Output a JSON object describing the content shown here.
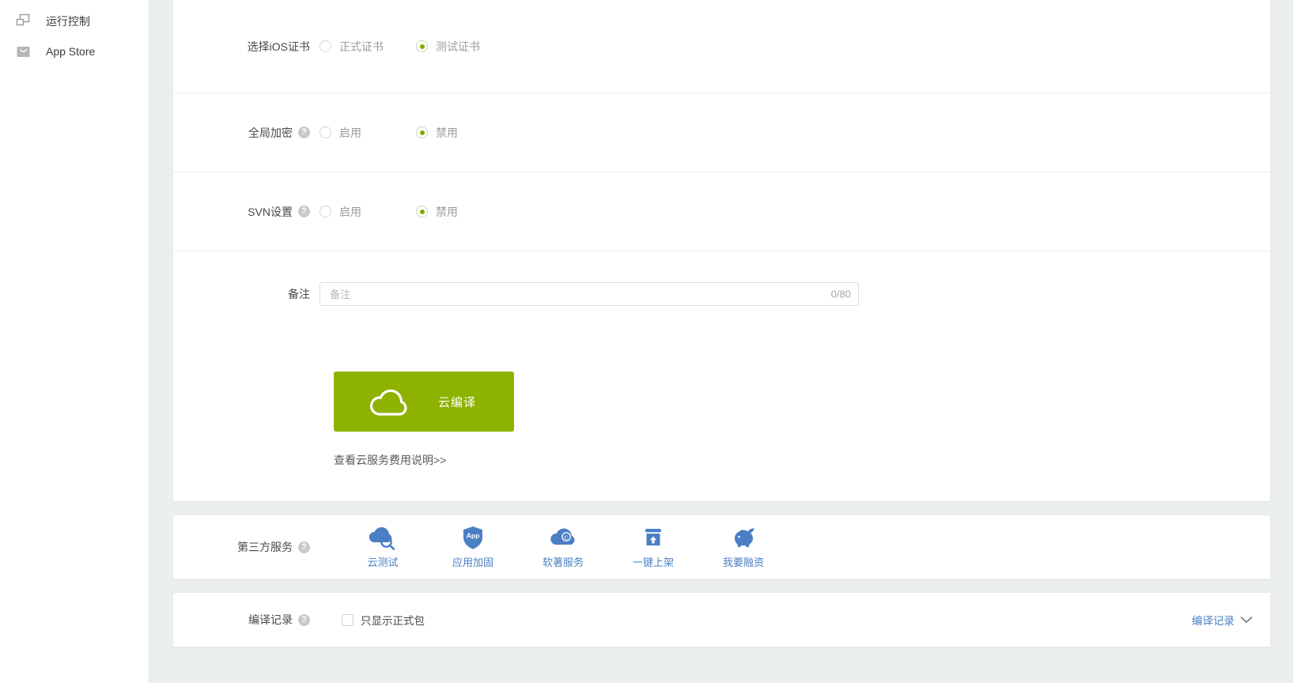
{
  "sidebar": {
    "items": [
      {
        "label": "运行控制",
        "icon": "windows-stack-icon"
      },
      {
        "label": "App Store",
        "icon": "app-store-bag-icon"
      }
    ]
  },
  "form": {
    "rows": [
      {
        "label": "选择iOS证书",
        "has_help": false,
        "options": [
          {
            "label": "正式证书",
            "checked": false
          },
          {
            "label": "测试证书",
            "checked": true
          }
        ]
      },
      {
        "label": "全局加密",
        "has_help": true,
        "help_icon": "question-mark-icon",
        "options": [
          {
            "label": "启用",
            "checked": false
          },
          {
            "label": "禁用",
            "checked": true
          }
        ]
      },
      {
        "label": "SVN设置",
        "has_help": true,
        "help_icon": "question-mark-icon",
        "options": [
          {
            "label": "启用",
            "checked": false
          },
          {
            "label": "禁用",
            "checked": true
          }
        ]
      }
    ],
    "remark": {
      "label": "备注",
      "placeholder": "备注",
      "value": "",
      "counter": "0/80"
    }
  },
  "compile": {
    "button_label": "云编译",
    "button_icon": "cloud-icon",
    "button_color": "#8db300",
    "fee_link": "查看云服务费用说明>>"
  },
  "third_party": {
    "label": "第三方服务",
    "help_icon": "question-mark-icon",
    "items": [
      {
        "label": "云测试",
        "icon": "cloud-search-icon"
      },
      {
        "label": "应用加固",
        "icon": "shield-app-icon"
      },
      {
        "label": "软著服务",
        "icon": "cloud-copyright-icon"
      },
      {
        "label": "一键上架",
        "icon": "box-upload-icon"
      },
      {
        "label": "我要融资",
        "icon": "piggy-bank-icon"
      }
    ],
    "accent_color": "#4a7fc4"
  },
  "records": {
    "label": "编译记录",
    "help_icon": "question-mark-icon",
    "checkbox_label": "只显示正式包",
    "checkbox_checked": false,
    "toggle_label": "编译记录",
    "toggle_icon": "chevron-down-icon"
  }
}
